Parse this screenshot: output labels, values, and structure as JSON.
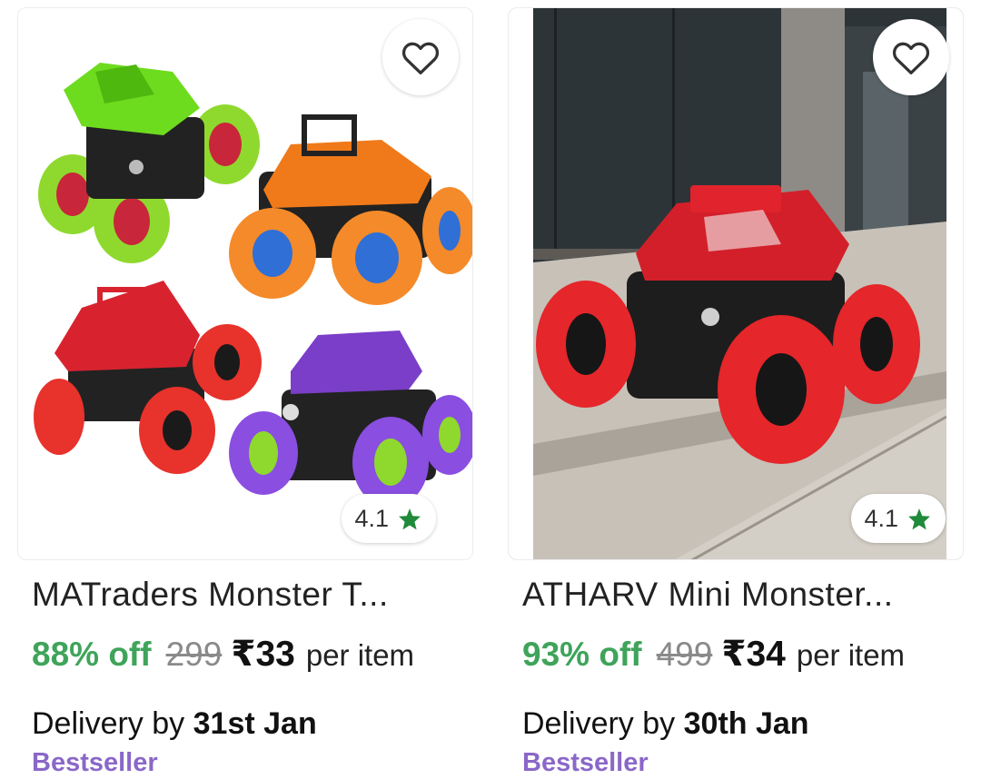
{
  "products": [
    {
      "title": "MATraders Monster T...",
      "discount": "88% off",
      "mrp": "299",
      "price": "₹33",
      "unit": "per item",
      "delivery_prefix": "Delivery by",
      "delivery_date": "31st Jan",
      "badge": "Bestseller",
      "rating": "4.1",
      "image_desc": "Four monster trucks: green, orange, red, purple"
    },
    {
      "title": "ATHARV Mini Monster...",
      "discount": "93% off",
      "mrp": "499",
      "price": "₹34",
      "unit": "per item",
      "delivery_prefix": "Delivery by",
      "delivery_date": "30th Jan",
      "badge": "Bestseller",
      "rating": "4.1",
      "image_desc": "Red monster truck on a sidewalk"
    }
  ],
  "colors": {
    "discount": "#3fa45a",
    "badge": "#8a67c9",
    "star": "#1f8a3a",
    "mrp": "#8a8a8a"
  },
  "icons": {
    "wishlist": "heart-outline-icon",
    "rating": "star-icon"
  }
}
